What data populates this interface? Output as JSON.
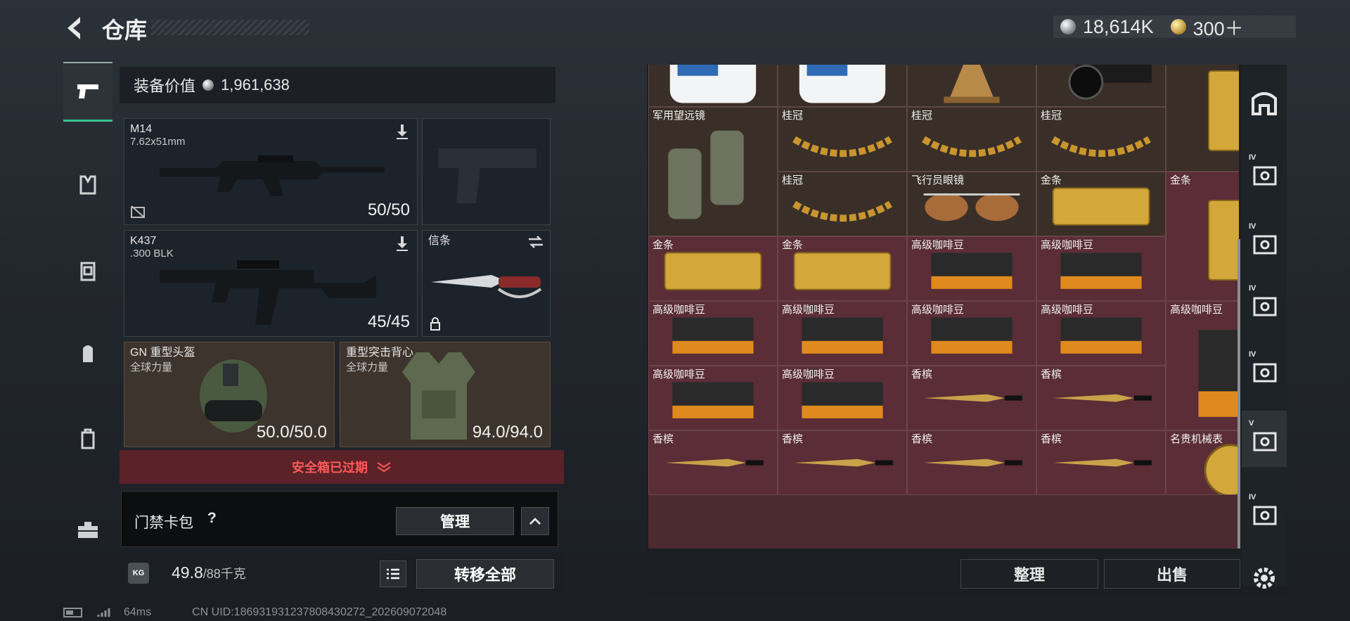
{
  "header": {
    "title": "仓库",
    "currency_silver": "18,614K",
    "currency_gold": "300＋"
  },
  "nav": {
    "items": [
      "pistol-icon",
      "vest-icon",
      "armor-icon",
      "backpack-icon",
      "case-icon",
      "toolbox-icon"
    ]
  },
  "loadout": {
    "equip_value_label": "装备价值",
    "equip_value": "1,961,638",
    "slots": [
      {
        "name": "M14",
        "sub": "7.62x51mm",
        "durability": "50/50"
      },
      {
        "name": "K437",
        "sub": ".300 BLK",
        "durability": "45/45"
      },
      {
        "name": "信条",
        "sub": "",
        "durability": ""
      },
      {
        "name": "GN 重型头盔",
        "sub": "全球力量",
        "durability": "50.0/50.0"
      },
      {
        "name": "重型突击背心",
        "sub": "全球力量",
        "durability": "94.0/94.0"
      }
    ],
    "safe_box_status": "安全箱已过期",
    "keycard_label": "门禁卡包",
    "keycard_help": "?",
    "manage_label": "管理",
    "weight_value": "49.8",
    "weight_cap": "/88千克",
    "weight_icon_text": "KG",
    "transfer_all_label": "转移全部"
  },
  "stash": {
    "items": [
      {
        "label": "",
        "icon": "fuel-jug-icon"
      },
      {
        "label": "",
        "icon": "fuel-jug-icon"
      },
      {
        "label": "",
        "icon": "antique-clock-icon"
      },
      {
        "label": "",
        "icon": "camera-icon"
      },
      {
        "label": "金条",
        "icon": "gold-bar-vertical-icon"
      },
      {
        "label": "军用望远镜",
        "icon": "binoculars-icon"
      },
      {
        "label": "桂冠",
        "icon": "laurel-crown-icon"
      },
      {
        "label": "桂冠",
        "icon": "laurel-crown-icon"
      },
      {
        "label": "桂冠",
        "icon": "laurel-crown-icon"
      },
      {
        "label": "桂冠",
        "icon": "laurel-crown-icon"
      },
      {
        "label": "飞行员眼镜",
        "icon": "aviator-glasses-icon"
      },
      {
        "label": "金条",
        "icon": "gold-bar-icon"
      },
      {
        "label": "金条",
        "icon": "gold-bar-vertical-icon"
      },
      {
        "label": "金条",
        "icon": "gold-bar-icon"
      },
      {
        "label": "金条",
        "icon": "gold-bar-icon"
      },
      {
        "label": "高级咖啡豆",
        "icon": "coffee-bag-icon"
      },
      {
        "label": "高级咖啡豆",
        "icon": "coffee-bag-icon"
      },
      {
        "label": "高级咖啡豆",
        "icon": "coffee-bag-icon"
      },
      {
        "label": "高级咖啡豆",
        "icon": "coffee-bag-icon"
      },
      {
        "label": "高级咖啡豆",
        "icon": "coffee-bag-icon"
      },
      {
        "label": "高级咖啡豆",
        "icon": "coffee-bag-icon"
      },
      {
        "label": "高级咖啡豆",
        "icon": "coffee-bag-vertical-icon"
      },
      {
        "label": "高级咖啡豆",
        "icon": "coffee-bag-icon"
      },
      {
        "label": "高级咖啡豆",
        "icon": "coffee-bag-icon"
      },
      {
        "label": "香槟",
        "icon": "champagne-icon"
      },
      {
        "label": "香槟",
        "icon": "champagne-icon"
      },
      {
        "label": "香槟",
        "icon": "champagne-icon"
      },
      {
        "label": "香槟",
        "icon": "champagne-icon"
      },
      {
        "label": "香槟",
        "icon": "champagne-icon"
      },
      {
        "label": "香槟",
        "icon": "champagne-icon"
      },
      {
        "label": "名贵机械表",
        "icon": "watch-icon"
      }
    ],
    "sort_label": "整理",
    "sell_label": "出售"
  },
  "right_tabs": [
    "stash-home-icon",
    "case-iv-icon",
    "case-iv-tools-icon",
    "case-iv-plus-icon",
    "case-iv-safe-icon",
    "case-v-safe-icon",
    "case-iv-triangle-icon",
    "settings-gear-icon"
  ],
  "right_tab_labels": [
    "",
    "IV",
    "IV",
    "IV",
    "IV",
    "V",
    "IV"
  ],
  "status": {
    "ping": "64ms",
    "uid": "CN UID:18693193123780843027​2_202609072048"
  },
  "colors": {
    "accent_green": "#3fbf93",
    "alert_red": "#ff5a5a",
    "stash_maroon": "#5b2d36",
    "stash_brown": "#3a2f28"
  }
}
